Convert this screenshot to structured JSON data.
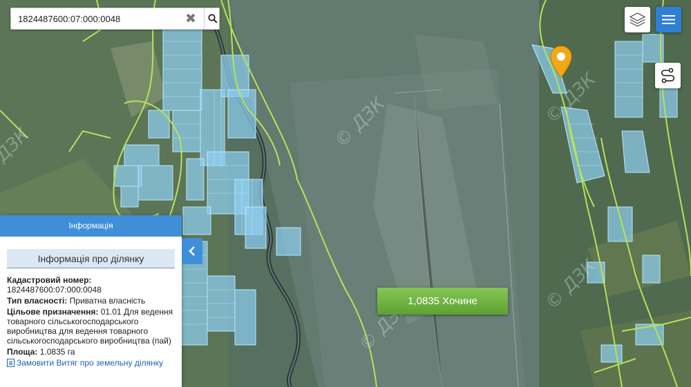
{
  "search": {
    "value": "1824487600:07:000:0048",
    "placeholder": ""
  },
  "icons": {
    "clear": "close-icon",
    "search": "search-icon",
    "layers": "layers-icon",
    "menu": "hamburger-menu-icon",
    "route": "route-icon",
    "pin": "map-pin-icon",
    "collapse": "chevron-left-icon",
    "document": "document-icon"
  },
  "map": {
    "watermark": "© ДЗК",
    "result_label": "1,0835 Хочине"
  },
  "info_panel": {
    "header": "Інформація",
    "title": "Інформація про ділянку",
    "cadastral_label": "Кадастровий номер:",
    "cadastral_value": "1824487600:07:000:0048",
    "ownership_label": "Тип власності:",
    "ownership_value": "Приватна власність",
    "purpose_label": "Цільове призначення:",
    "purpose_value": "01.01 Для ведення товарного сільськогосподарського виробництва для ведення товарного сільськогосподарського виробництва (пай)",
    "area_label": "Площа:",
    "area_value": "1.0835 га",
    "order_link": "Замовити Витяг про земельну ділянку"
  },
  "colors": {
    "accent": "#3f8ed8",
    "boundary": "#b6e35a",
    "parcel_fill": "#8fd0f2",
    "result_green": "#6db23d",
    "pin": "#f3a712",
    "map_base": "#566f63"
  }
}
